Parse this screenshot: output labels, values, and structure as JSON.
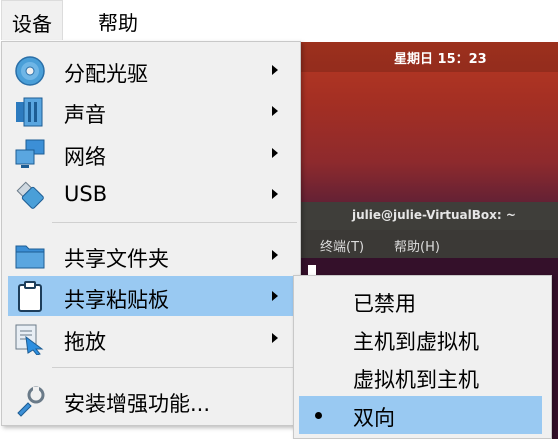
{
  "menubar": {
    "items": [
      {
        "label": "设备",
        "active": true
      },
      {
        "label": "帮助",
        "active": false
      }
    ]
  },
  "devices_menu": {
    "items": [
      {
        "label": "分配光驱",
        "icon": "optical-disc-icon",
        "submenu": true
      },
      {
        "label": "声音",
        "icon": "audio-icon",
        "submenu": true
      },
      {
        "label": "网络",
        "icon": "network-icon",
        "submenu": true
      },
      {
        "label": "USB",
        "icon": "usb-icon",
        "submenu": true
      },
      {
        "label": "共享文件夹",
        "icon": "shared-folder-icon",
        "submenu": true
      },
      {
        "label": "共享粘贴板",
        "icon": "clipboard-icon",
        "submenu": true,
        "highlighted": true
      },
      {
        "label": "拖放",
        "icon": "drag-drop-icon",
        "submenu": true
      },
      {
        "label": "安装增强功能...",
        "icon": "install-guest-additions-icon",
        "submenu": false
      }
    ]
  },
  "clipboard_submenu": {
    "items": [
      {
        "label": "已禁用",
        "checked": false
      },
      {
        "label": "主机到虚拟机",
        "checked": false
      },
      {
        "label": "虚拟机到主机",
        "checked": false
      },
      {
        "label": "双向",
        "checked": true,
        "highlighted": true
      }
    ]
  },
  "guest_screen": {
    "clock": "星期日 15：23",
    "terminal_title": "julie@julie-VirtualBox: ~",
    "terminal_menu": [
      "终端(T)",
      "帮助(H)"
    ]
  },
  "colors": {
    "highlight": "#99c9f2",
    "menu_bg": "#f0f0f0",
    "ubuntu_orange": "#b83a23",
    "terminal_bg": "#34102a"
  }
}
